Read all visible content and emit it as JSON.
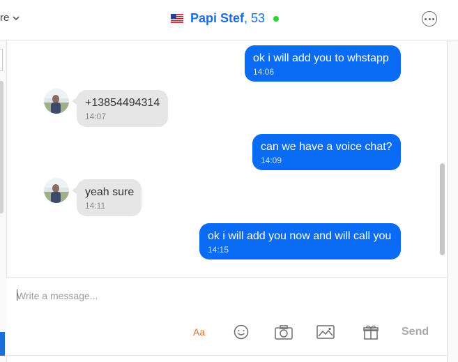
{
  "header": {
    "left_menu_label": "re",
    "contact_name": "Papi Stef",
    "contact_age": ", 53",
    "status": "online"
  },
  "messages": [
    {
      "direction": "out",
      "text": "ok i will add you to whstapp",
      "time": "14:06"
    },
    {
      "direction": "in",
      "text": "+13854494314",
      "time": "14:07"
    },
    {
      "direction": "out",
      "text": "can we have a voice chat?",
      "time": "14:09"
    },
    {
      "direction": "in",
      "text": "yeah sure",
      "time": "14:11"
    },
    {
      "direction": "out",
      "text": "ok i will add you now and will call you",
      "time": "14:15"
    }
  ],
  "composer": {
    "placeholder": "Write a message...",
    "font_label": "Aa",
    "send_label": "Send"
  },
  "colors": {
    "accent": "#0a6cf5",
    "online": "#2ed52e",
    "font_tool": "#e26b1e"
  },
  "icons": [
    "chevron-down-icon",
    "us-flag-icon",
    "more-options-icon",
    "emoji-icon",
    "camera-icon",
    "image-icon",
    "gift-icon"
  ]
}
